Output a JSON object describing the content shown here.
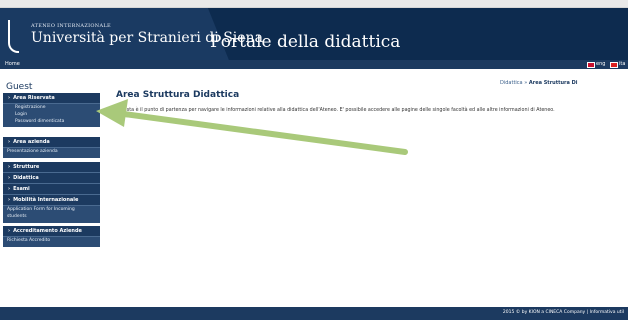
{
  "header": {
    "ateneo_label": "ATENEO INTERNAZIONALE",
    "university_name": "Università per Stranieri di Siena",
    "portal_title": "Portale della didattica"
  },
  "navbar": {
    "home_label": "Home",
    "lang_en": "eng",
    "lang_it": "ita"
  },
  "breadcrumb": {
    "parent": "Didattica",
    "separator": "»",
    "current": "Area Struttura Di"
  },
  "sidebar": {
    "title": "Guest",
    "sections": [
      {
        "label": "Area Riservata",
        "items": [
          "Registrazione",
          "Login",
          "Password dimenticata"
        ]
      },
      {
        "label": "Area azienda",
        "items": [
          "Presentazione azienda"
        ]
      },
      {
        "label": "Strutture",
        "items": []
      },
      {
        "label": "Didattica",
        "items": []
      },
      {
        "label": "Esami",
        "items": []
      },
      {
        "label": "Mobilità Internazionale",
        "items": [
          "Application Form for Incoming students"
        ]
      },
      {
        "label": "Accreditamento Aziende",
        "items": [
          "Richiesta Accredito"
        ]
      }
    ]
  },
  "main": {
    "heading": "Area Struttura Didattica",
    "intro": "Questa è il punto di partenza per navigare le informazioni relative alla didattica dell'Ateneo. E' possibile accedere alle pagine delle singole facoltà ed alle altre informazioni di Ateneo."
  },
  "footer": {
    "text": "2015 © by KION a CINECA Company  |  Informativa util"
  },
  "colors": {
    "header_bg": "#0d2b4f",
    "nav_bg": "#1c3a60",
    "annotation_arrow": "#a9c97a"
  }
}
